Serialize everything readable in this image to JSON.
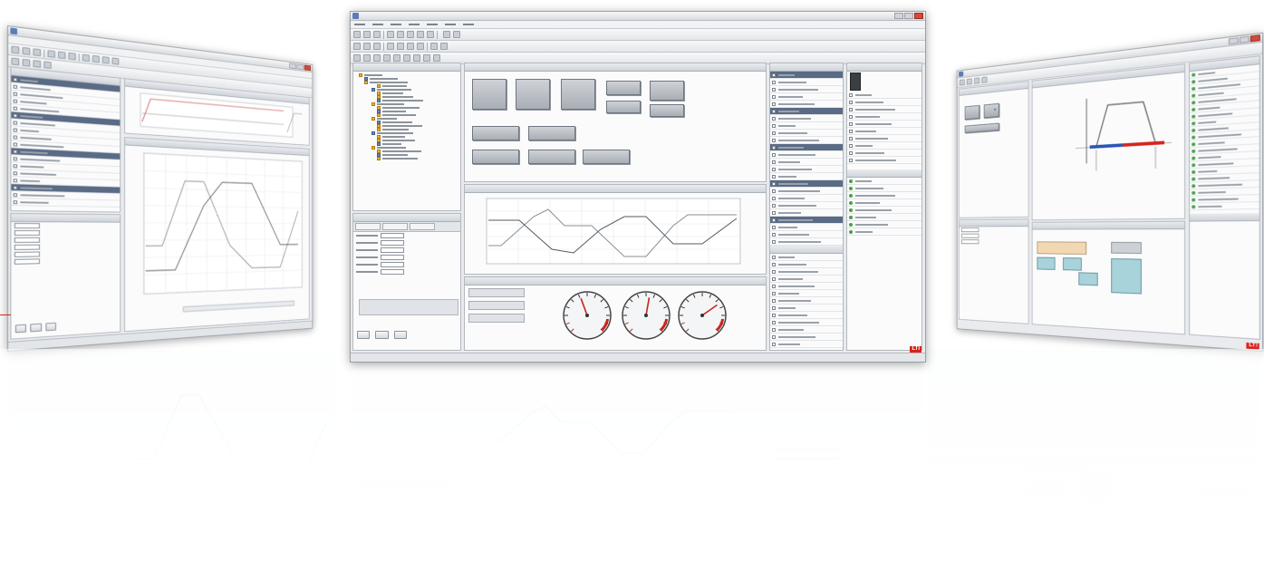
{
  "center": {
    "title": "",
    "menu": [],
    "toolbar_label_1": "",
    "tree_items": [],
    "props_title": "",
    "props_tabs": [],
    "props_rows": [],
    "props_buttons": [],
    "designer_title": "",
    "controls": [],
    "scope_title": "",
    "gauge_panel_title": "",
    "gauge_labels": [],
    "right_list_a": [],
    "right_list_b": [],
    "right_list_c": [],
    "right_list_d": [],
    "logo": "LTI"
  },
  "left": {
    "title": "",
    "list": [],
    "panel_title": ""
  },
  "right": {
    "title": "",
    "list": [],
    "panel_title": "",
    "logo": "LTI"
  }
}
